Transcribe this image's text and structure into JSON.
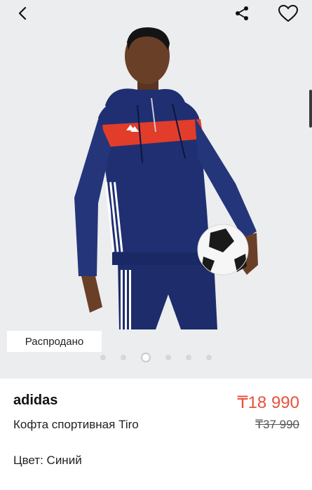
{
  "gallery": {
    "badge": "Распродано",
    "total_slides": 6,
    "active_slide": 3
  },
  "product": {
    "brand": "adidas",
    "name": "Кофта спортивная Tiro",
    "price": "₸18 990",
    "old_price": "₸37 990",
    "color_label": "Цвет:",
    "color_value": "Синий",
    "color_text": "Цвет: Синий"
  },
  "icons": {
    "back": "chevron-left-icon",
    "share": "share-icon",
    "favorite": "heart-icon"
  },
  "colors": {
    "price": "#e8513d",
    "hero_background": "#ebedee",
    "hoodie": "#1f2f72",
    "stripe": "#e23c2a"
  }
}
